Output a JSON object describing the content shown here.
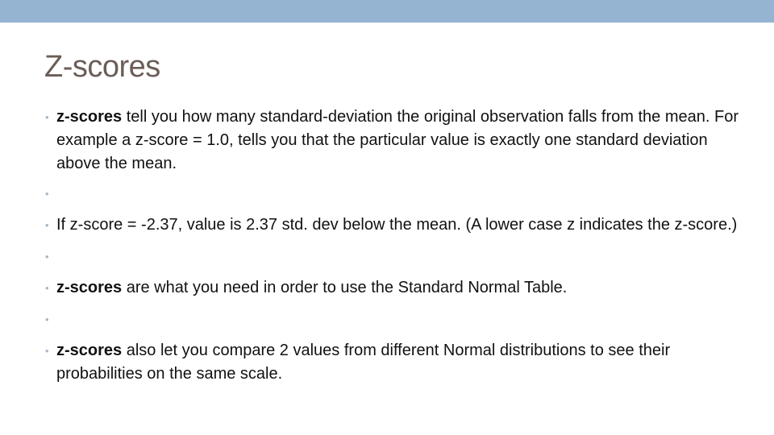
{
  "slide": {
    "title": "Z-scores",
    "bullets": [
      {
        "bold": "z-scores",
        "text": " tell you how many standard-deviation the original observation falls from the mean.  For example a z-score = 1.0, tells you that the particular value is exactly one standard deviation above the mean."
      },
      {
        "bold": "",
        "text": ""
      },
      {
        "bold": "",
        "text": "If z-score  = -2.37, value is 2.37 std. dev below the mean.  (A lower case z indicates the z-score.)"
      },
      {
        "bold": "",
        "text": ""
      },
      {
        "bold": "z-scores",
        "text": " are what you need in order to use the Standard Normal Table."
      },
      {
        "bold": "",
        "text": ""
      },
      {
        "bold": "z-scores",
        "text": " also let you compare 2 values from different Normal distributions to see their probabilities on the same scale."
      }
    ],
    "bullet_glyph": "•",
    "colors": {
      "top_bar": "#94b4d1",
      "title": "#6b5d57",
      "bullet": "#a3b7c7"
    }
  }
}
